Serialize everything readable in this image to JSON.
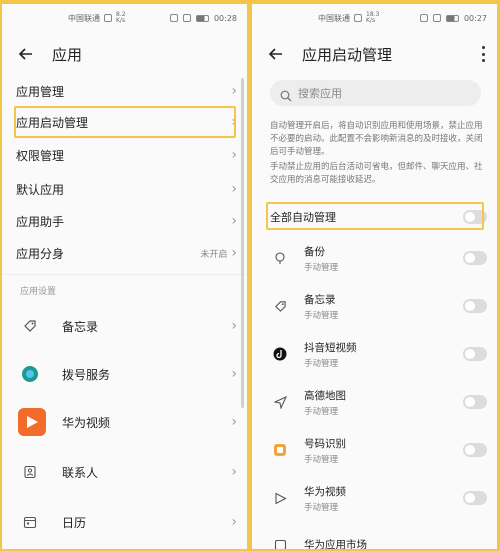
{
  "left": {
    "status": {
      "net": "中国联通",
      "speed": "8.2\nK/s",
      "time": "00:28"
    },
    "title": "应用",
    "menu": [
      {
        "label": "应用管理",
        "value": ""
      },
      {
        "label": "应用启动管理",
        "value": ""
      },
      {
        "label": "权限管理",
        "value": ""
      },
      {
        "label": "默认应用",
        "value": ""
      },
      {
        "label": "应用助手",
        "value": ""
      },
      {
        "label": "应用分身",
        "value": "未开启"
      }
    ],
    "section_label": "应用设置",
    "apps": [
      {
        "name": "备忘录",
        "icon": "tag-icon"
      },
      {
        "name": "拨号服务",
        "icon": "dialer-icon"
      },
      {
        "name": "华为视频",
        "icon": "video-icon"
      },
      {
        "name": "联系人",
        "icon": "contacts-icon"
      },
      {
        "name": "日历",
        "icon": "calendar-icon"
      }
    ]
  },
  "right": {
    "status": {
      "net": "中国联通",
      "speed": "18.3\nK/s",
      "time": "00:27"
    },
    "title": "应用启动管理",
    "search_placeholder": "搜索应用",
    "desc1": "自动管理开启后，将自动识别应用和使用场景，禁止应用不必要的启动。此配置不会影响新消息的及时接收，关闭后可手动管理。",
    "desc2": "手动禁止应用的后台活动可省电，但邮件、聊天应用、社交应用的消息可能接收延迟。",
    "all_label": "全部自动管理",
    "apps": [
      {
        "name": "备份",
        "sub": "手动管理",
        "icon": "backup-icon"
      },
      {
        "name": "备忘录",
        "sub": "手动管理",
        "icon": "tag-icon"
      },
      {
        "name": "抖音短视频",
        "sub": "手动管理",
        "icon": "douyin-icon"
      },
      {
        "name": "高德地图",
        "sub": "手动管理",
        "icon": "navigation-icon"
      },
      {
        "name": "号码识别",
        "sub": "手动管理",
        "icon": "number-id-icon"
      },
      {
        "name": "华为视频",
        "sub": "手动管理",
        "icon": "video-icon"
      },
      {
        "name": "华为应用市场",
        "sub": "",
        "icon": "appstore-icon"
      }
    ]
  },
  "colors": {
    "highlight": "#f3c64a",
    "video_orange": "#f26b2a"
  }
}
